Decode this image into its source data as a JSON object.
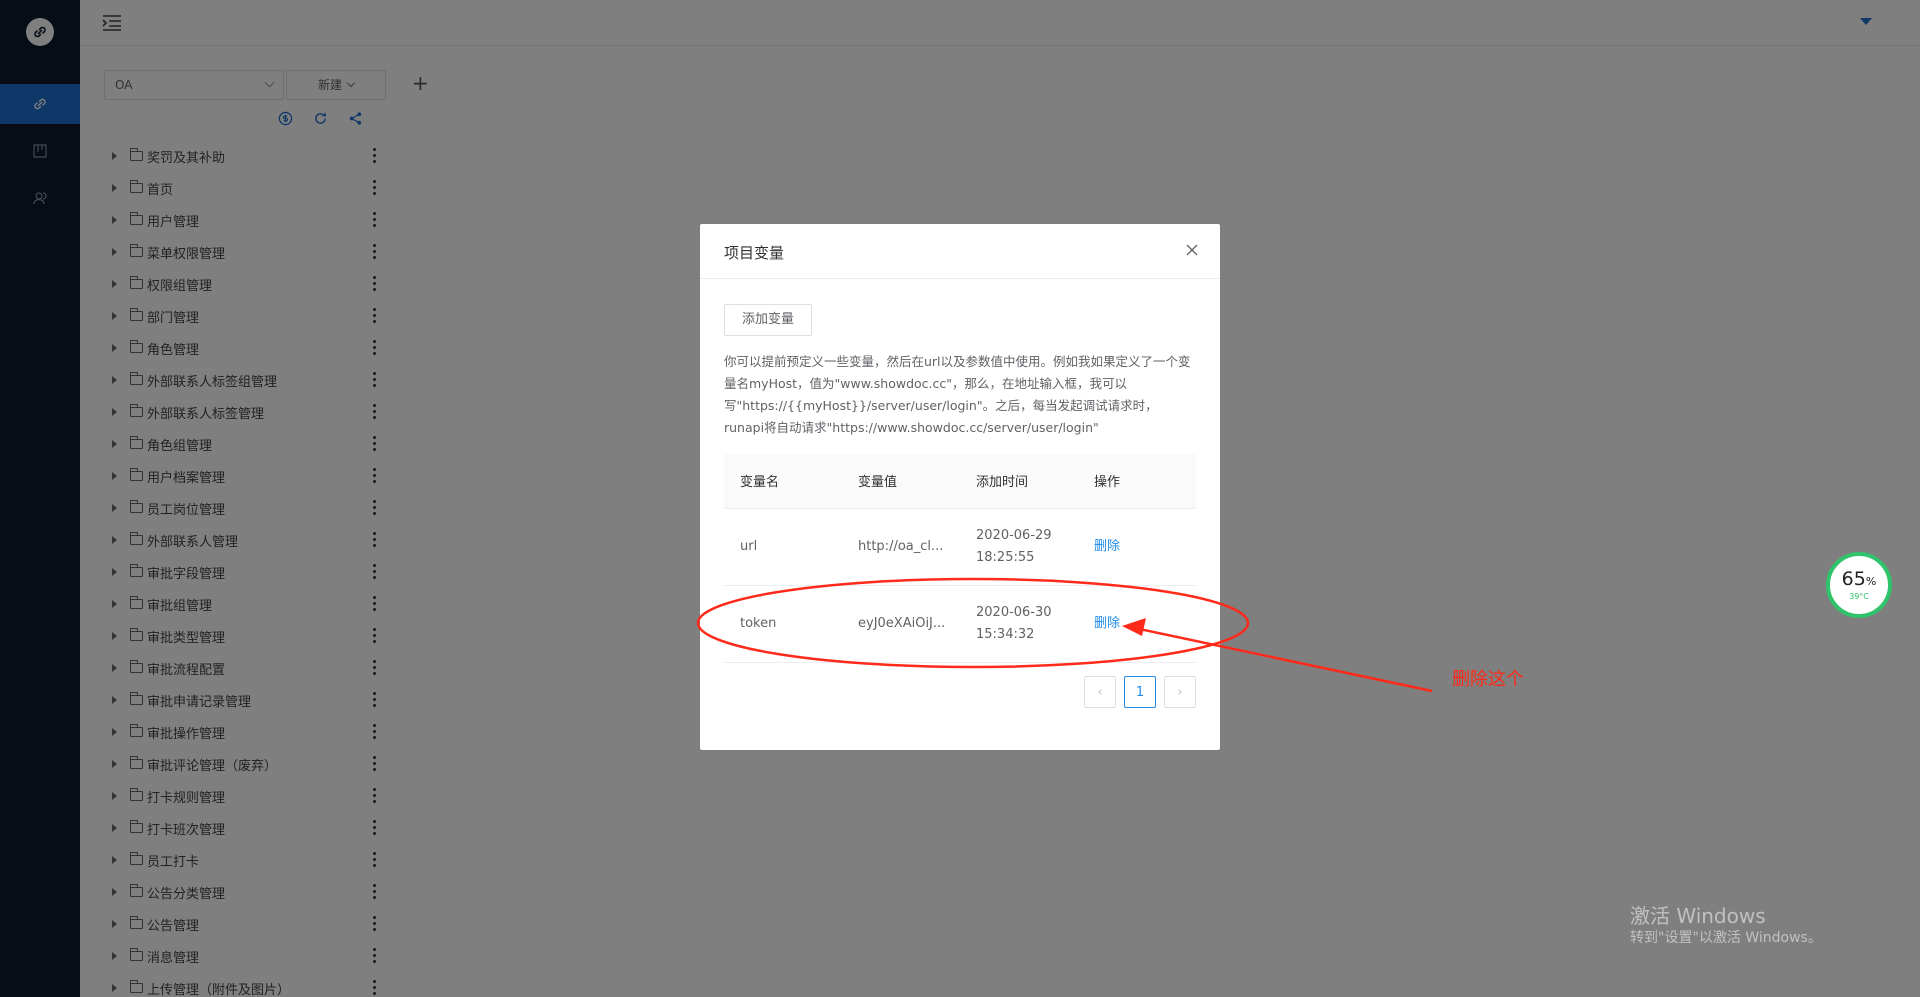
{
  "colors": {
    "nav_bg": "#0d1b2e",
    "accent": "#1f6fd1",
    "link": "#1f8ceb",
    "annotation": "#ff2a1a",
    "widget_ring": "#2fc36b"
  },
  "nav": {
    "logo": "link-icon",
    "items": [
      "link-icon",
      "board-icon",
      "team-icon"
    ]
  },
  "sidebar": {
    "project": "OA",
    "new_label": "新建",
    "plus": "+",
    "tools": [
      "dollar-icon",
      "refresh-icon",
      "share-icon"
    ],
    "tree": [
      "奖罚及其补助",
      "首页",
      "用户管理",
      "菜单权限管理",
      "权限组管理",
      "部门管理",
      "角色管理",
      "外部联系人标签组管理",
      "外部联系人标签管理",
      "角色组管理",
      "用户档案管理",
      "员工岗位管理",
      "外部联系人管理",
      "审批字段管理",
      "审批组管理",
      "审批类型管理",
      "审批流程配置",
      "审批申请记录管理",
      "审批操作管理",
      "审批评论管理（废弃）",
      "打卡规则管理",
      "打卡班次管理",
      "员工打卡",
      "公告分类管理",
      "公告管理",
      "消息管理",
      "上传管理（附件及图片）"
    ]
  },
  "modal": {
    "title": "项目变量",
    "add_button": "添加变量",
    "description": "你可以提前预定义一些变量，然后在url以及参数值中使用。例如我如果定义了一个变量名myHost，值为\"www.showdoc.cc\"，那么，在地址输入框，我可以写\"https://{{myHost}}/server/user/login\"。之后，每当发起调试请求时，runapi将自动请求\"https://www.showdoc.cc/server/user/login\"",
    "columns": [
      "变量名",
      "变量值",
      "添加时间",
      "操作"
    ],
    "rows": [
      {
        "name": "url",
        "value": "http://oa_cl...",
        "date": "2020-06-29",
        "time": "18:25:55",
        "action": "删除"
      },
      {
        "name": "token",
        "value": "eyJ0eXAiOiJ...",
        "date": "2020-06-30",
        "time": "15:34:32",
        "action": "删除"
      }
    ],
    "pagination": {
      "prev": "‹",
      "current": "1",
      "next": "›"
    }
  },
  "annotation": {
    "text": "删除这个"
  },
  "widget": {
    "percent": "65",
    "percent_unit": "%",
    "temp": "39°C"
  },
  "watermark": {
    "line1": "激活 Windows",
    "line2": "转到\"设置\"以激活 Windows。"
  }
}
